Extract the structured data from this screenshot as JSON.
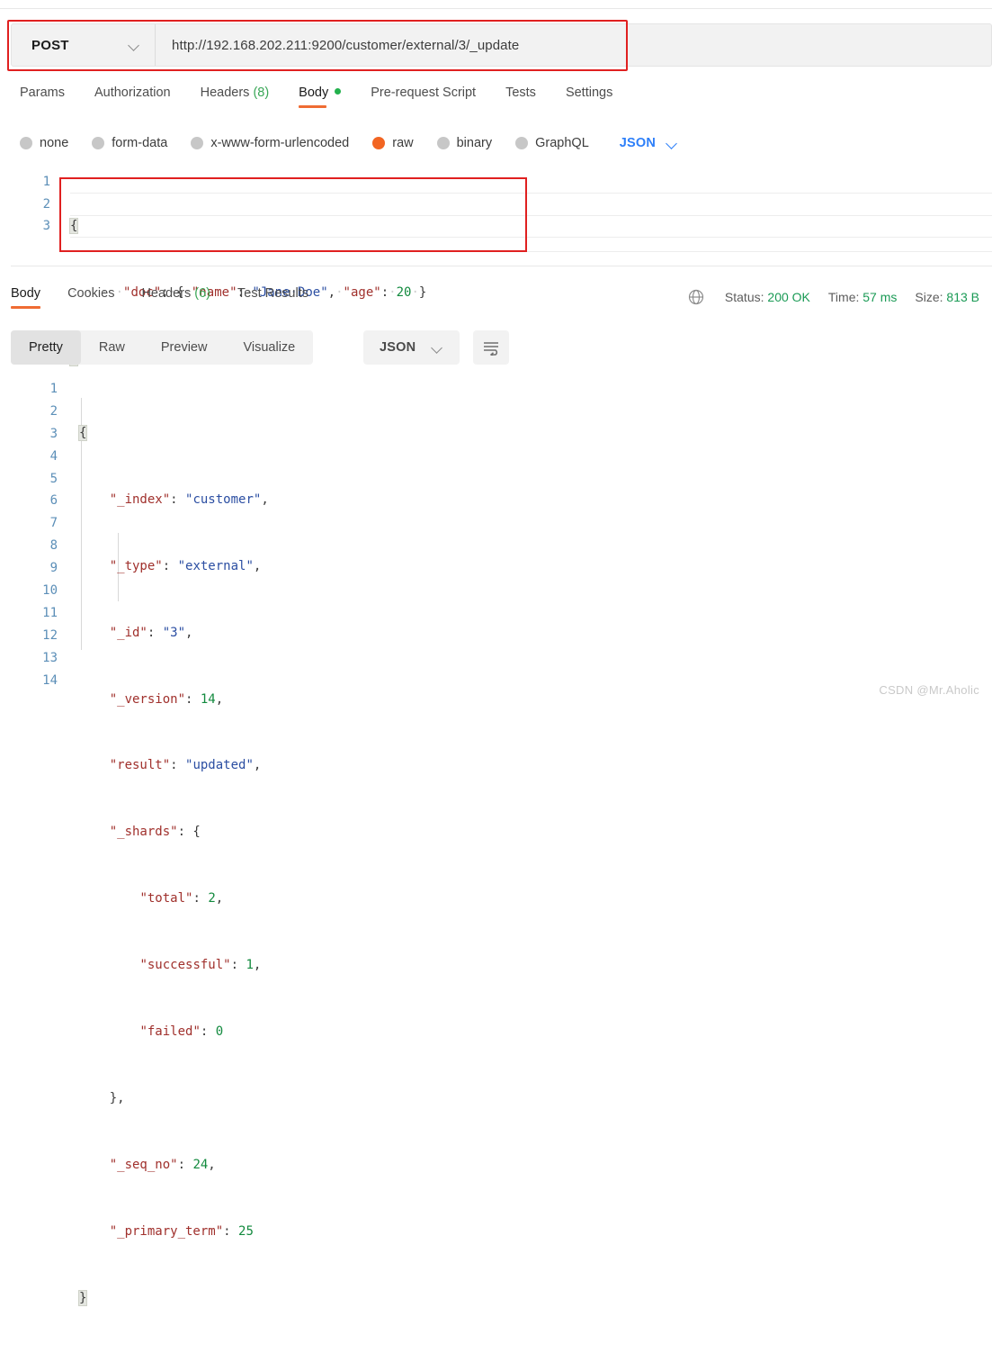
{
  "request": {
    "method": "POST",
    "url": "http://192.168.202.211:9200/customer/external/3/_update",
    "tabs": [
      {
        "label": "Params",
        "count": "",
        "active": false,
        "dot": false
      },
      {
        "label": "Authorization",
        "count": "",
        "active": false,
        "dot": false
      },
      {
        "label": "Headers",
        "count": "(8)",
        "active": false,
        "dot": false
      },
      {
        "label": "Body",
        "count": "",
        "active": true,
        "dot": true
      },
      {
        "label": "Pre-request Script",
        "count": "",
        "active": false,
        "dot": false
      },
      {
        "label": "Tests",
        "count": "",
        "active": false,
        "dot": false
      },
      {
        "label": "Settings",
        "count": "",
        "active": false,
        "dot": false
      }
    ],
    "body_types": [
      {
        "label": "none",
        "selected": false
      },
      {
        "label": "form-data",
        "selected": false
      },
      {
        "label": "x-www-form-urlencoded",
        "selected": false
      },
      {
        "label": "raw",
        "selected": true
      },
      {
        "label": "binary",
        "selected": false
      },
      {
        "label": "GraphQL",
        "selected": false
      }
    ],
    "raw_format": "JSON",
    "body_line_numbers": [
      "1",
      "2",
      "3"
    ],
    "body_code": "{\n    \"doc\": { \"name\": \"Jane Doe\", \"age\": 20 }\n}"
  },
  "response": {
    "tabs": [
      {
        "label": "Body",
        "count": "",
        "active": true
      },
      {
        "label": "Cookies",
        "count": "",
        "active": false
      },
      {
        "label": "Headers",
        "count": "(6)",
        "active": false
      },
      {
        "label": "Test Results",
        "count": "",
        "active": false
      }
    ],
    "status_label": "Status:",
    "status_value": "200 OK",
    "time_label": "Time:",
    "time_value": "57 ms",
    "size_label": "Size:",
    "size_value": "813 B",
    "view_modes": [
      {
        "label": "Pretty",
        "active": true
      },
      {
        "label": "Raw",
        "active": false
      },
      {
        "label": "Preview",
        "active": false
      },
      {
        "label": "Visualize",
        "active": false
      }
    ],
    "format": "JSON",
    "line_numbers": [
      "1",
      "2",
      "3",
      "4",
      "5",
      "6",
      "7",
      "8",
      "9",
      "10",
      "11",
      "12",
      "13",
      "14"
    ],
    "body_json": {
      "_index": "customer",
      "_type": "external",
      "_id": "3",
      "_version": 14,
      "result": "updated",
      "_shards": {
        "total": 2,
        "successful": 1,
        "failed": 0
      },
      "_seq_no": 24,
      "_primary_term": 25
    }
  },
  "annotations": {
    "highlight_color": "#e02020",
    "url_box": true,
    "body_box": true
  },
  "watermark": "CSDN @Mr.Aholic"
}
